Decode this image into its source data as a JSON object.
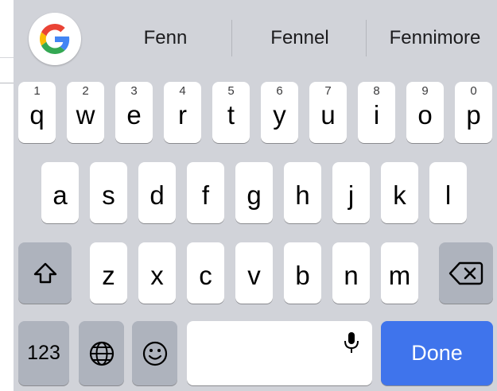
{
  "suggestions": [
    "Fenn",
    "Fennel",
    "Fennimore"
  ],
  "row1": [
    {
      "ch": "q",
      "sub": "1"
    },
    {
      "ch": "w",
      "sub": "2"
    },
    {
      "ch": "e",
      "sub": "3"
    },
    {
      "ch": "r",
      "sub": "4"
    },
    {
      "ch": "t",
      "sub": "5"
    },
    {
      "ch": "y",
      "sub": "6"
    },
    {
      "ch": "u",
      "sub": "7"
    },
    {
      "ch": "i",
      "sub": "8"
    },
    {
      "ch": "o",
      "sub": "9"
    },
    {
      "ch": "p",
      "sub": "0"
    }
  ],
  "row2": [
    "a",
    "s",
    "d",
    "f",
    "g",
    "h",
    "j",
    "k",
    "l"
  ],
  "row3": [
    "z",
    "x",
    "c",
    "v",
    "b",
    "n",
    "m"
  ],
  "bottom": {
    "numbers_label": "123",
    "done_label": "Done"
  },
  "icons": {
    "google": "google-g-icon",
    "shift": "shift-arrow-icon",
    "backspace": "backspace-icon",
    "globe": "globe-icon",
    "emoji": "emoji-face-icon",
    "mic": "microphone-icon"
  },
  "colors": {
    "keyboard_bg": "#d1d3d9",
    "key_bg": "#ffffff",
    "function_key_bg": "#aeb3bd",
    "done_bg": "#3f74ec"
  }
}
